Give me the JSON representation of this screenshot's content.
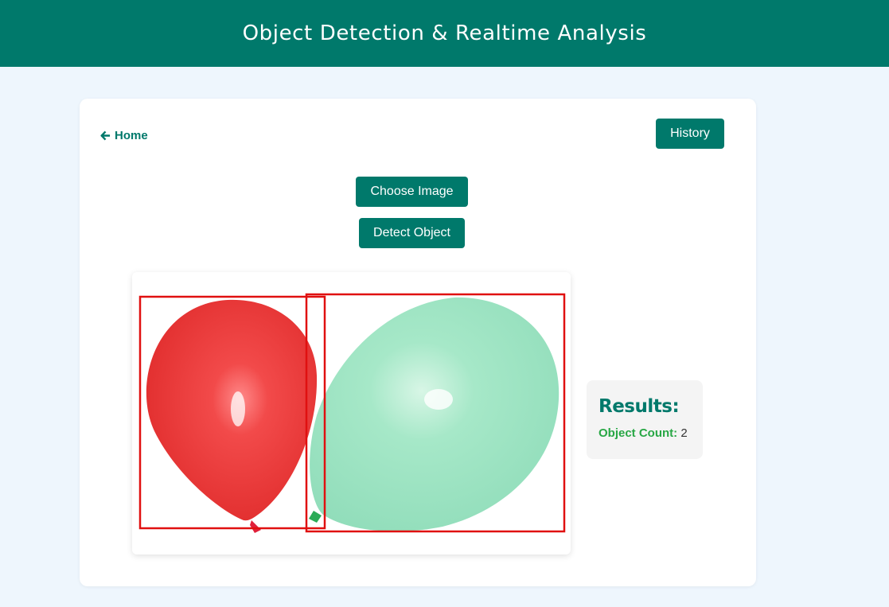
{
  "header": {
    "title": "Object Detection & Realtime Analysis"
  },
  "nav": {
    "home_label": "Home"
  },
  "actions": {
    "history_label": "History",
    "choose_image_label": "Choose Image",
    "detect_object_label": "Detect Object"
  },
  "results": {
    "title": "Results:",
    "object_count_label": "Object Count:",
    "object_count_value": "2"
  },
  "image": {
    "detections": [
      {
        "object": "red balloon",
        "box_color": "#e01010"
      },
      {
        "object": "green balloon",
        "box_color": "#e01010"
      }
    ]
  },
  "colors": {
    "primary": "#00796b",
    "background": "#eef6fd",
    "count_label": "#28a745",
    "detection_box": "#e01010"
  }
}
